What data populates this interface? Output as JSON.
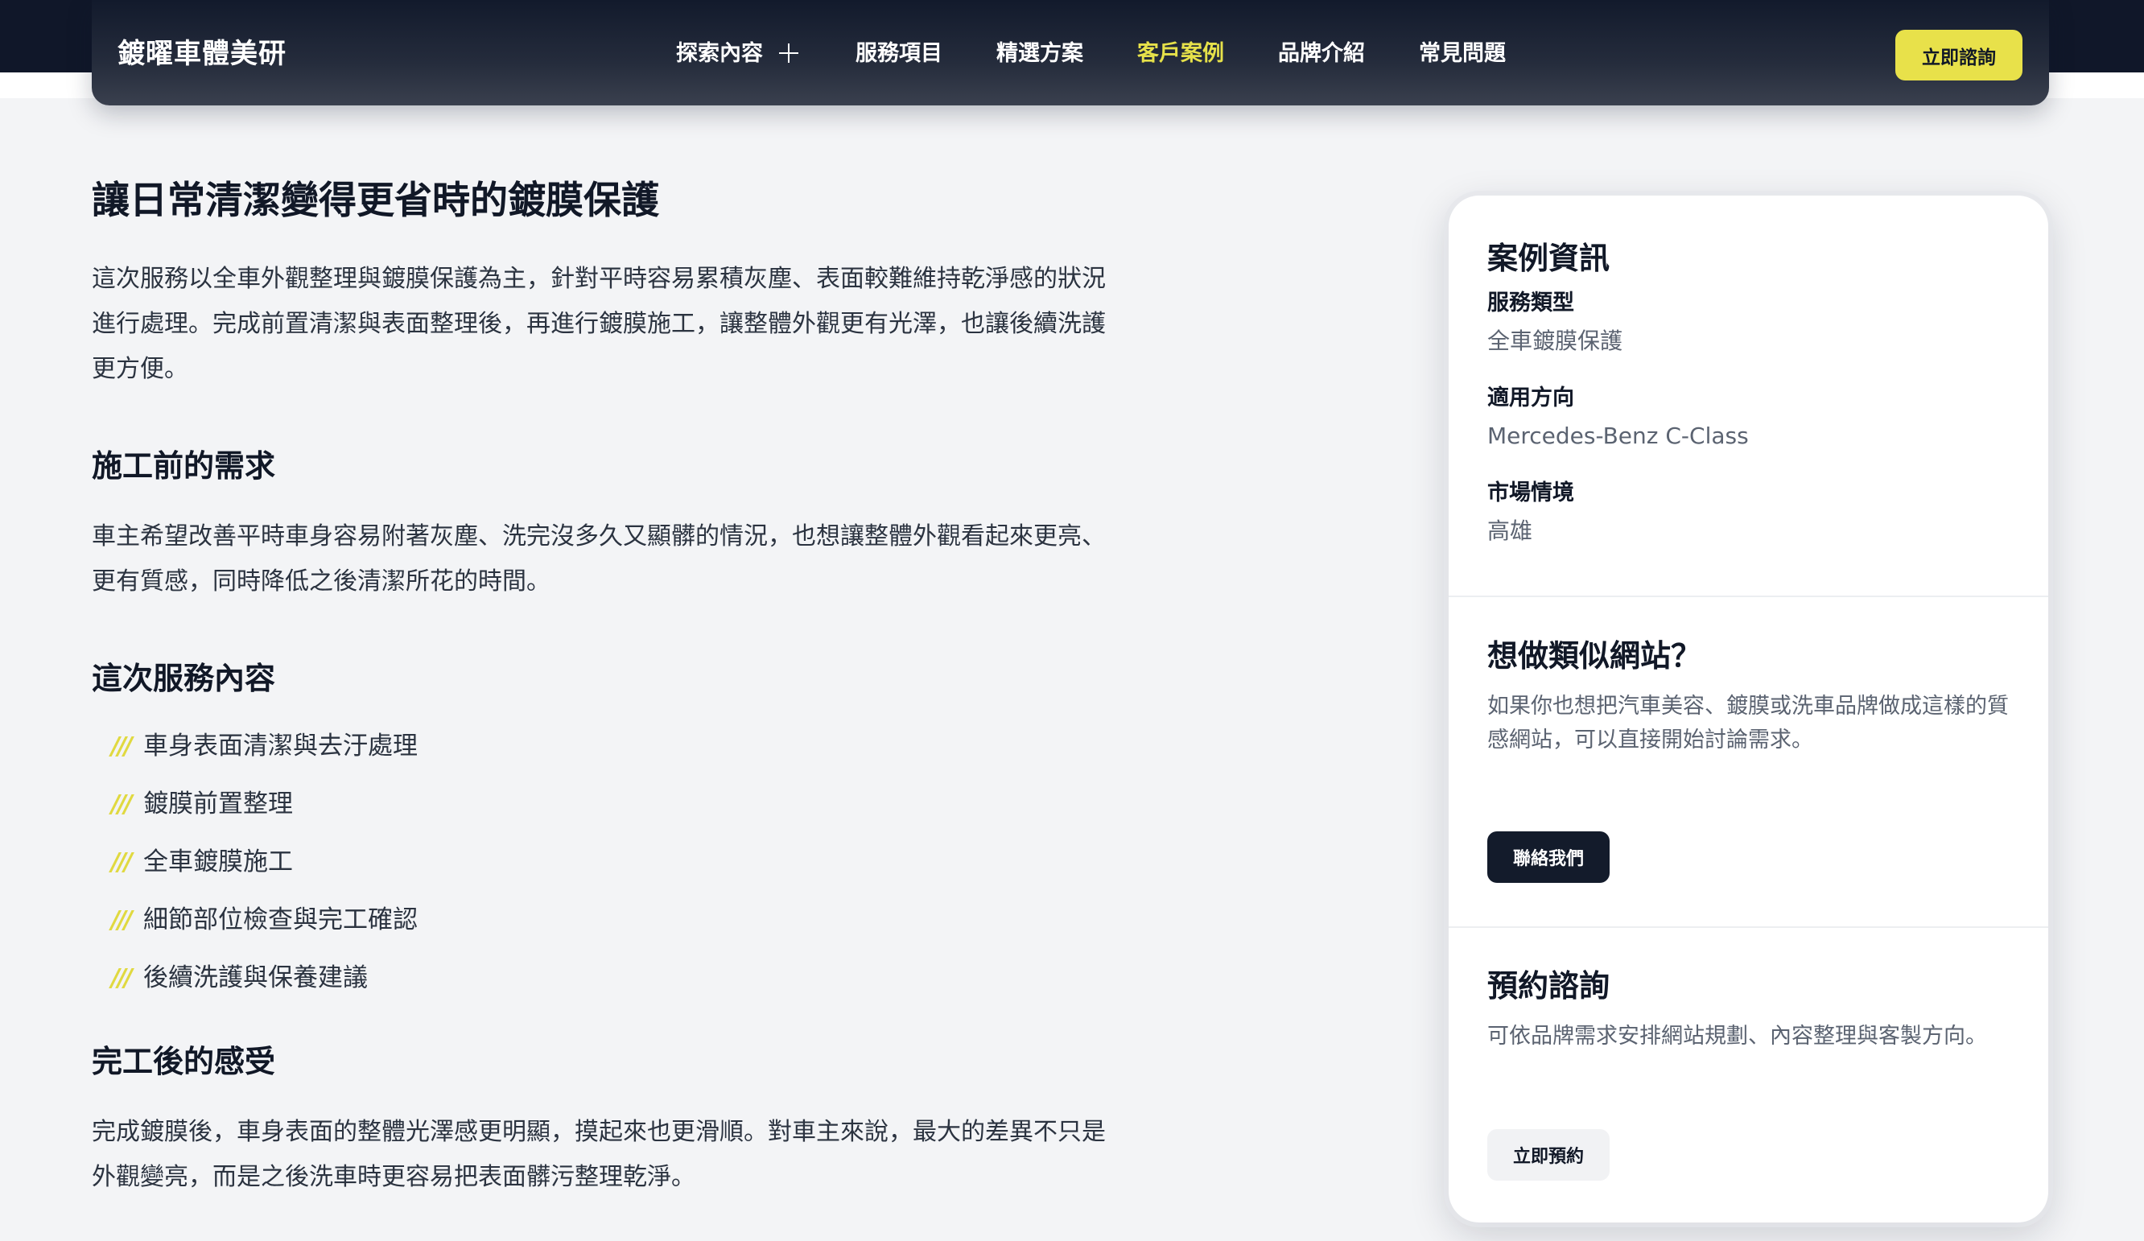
{
  "header": {
    "brand": "鍍曜車體美研",
    "nav": [
      {
        "label": "探索內容",
        "active": false,
        "has_plus": true
      },
      {
        "label": "服務項目",
        "active": false
      },
      {
        "label": "精選方案",
        "active": false
      },
      {
        "label": "客戶案例",
        "active": true
      },
      {
        "label": "品牌介紹",
        "active": false
      },
      {
        "label": "常見問題",
        "active": false
      }
    ],
    "cta_label": "立即諮詢",
    "accent_color": "#e8e14a",
    "dark_color": "#101729"
  },
  "article": {
    "title": "讓日常清潔變得更省時的鍍膜保護",
    "intro": "這次服務以全車外觀整理與鍍膜保護為主，針對平時容易累積灰塵、表面較難維持乾淨感的狀況進行處理。完成前置清潔與表面整理後，再進行鍍膜施工，讓整體外觀更有光澤，也讓後續洗護更方便。",
    "sections": [
      {
        "heading": "施工前的需求",
        "body": "車主希望改善平時車身容易附著灰塵、洗完沒多久又顯髒的情況，也想讓整體外觀看起來更亮、更有質感，同時降低之後清潔所花的時間。"
      },
      {
        "heading": "這次服務內容",
        "bullet_marker": "///",
        "items": [
          "車身表面清潔與去汙處理",
          "鍍膜前置整理",
          "全車鍍膜施工",
          "細節部位檢查與完工確認",
          "後續洗護與保養建議"
        ]
      },
      {
        "heading": "完工後的感受",
        "body": "完成鍍膜後，車身表面的整體光澤感更明顯，摸起來也更滑順。對車主來說，最大的差異不只是外觀變亮，而是之後洗車時更容易把表面髒污整理乾淨。"
      }
    ]
  },
  "sidebar": {
    "case_info": {
      "title": "案例資訊",
      "fields": [
        {
          "label": "服務類型",
          "value": "全車鍍膜保護"
        },
        {
          "label": "適用方向",
          "value": "Mercedes-Benz C-Class"
        },
        {
          "label": "市場情境",
          "value": "高雄"
        }
      ]
    },
    "similar_site": {
      "title": "想做類似網站？",
      "text": "如果你也想把汽車美容、鍍膜或洗車品牌做成這樣的質感網站，可以直接開始討論需求。",
      "button": "聯絡我們"
    },
    "booking": {
      "title": "預約諮詢",
      "text": "可依品牌需求安排網站規劃、內容整理與客製方向。",
      "button": "立即預約"
    }
  }
}
